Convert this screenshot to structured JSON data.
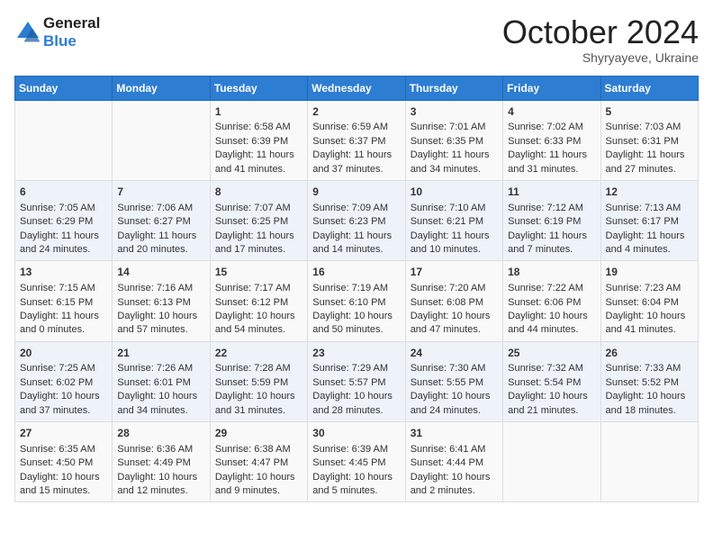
{
  "header": {
    "logo_line1": "General",
    "logo_line2": "Blue",
    "month_title": "October 2024",
    "subtitle": "Shyryayeve, Ukraine"
  },
  "days_of_week": [
    "Sunday",
    "Monday",
    "Tuesday",
    "Wednesday",
    "Thursday",
    "Friday",
    "Saturday"
  ],
  "weeks": [
    [
      {
        "day": "",
        "lines": []
      },
      {
        "day": "",
        "lines": []
      },
      {
        "day": "1",
        "lines": [
          "Sunrise: 6:58 AM",
          "Sunset: 6:39 PM",
          "Daylight: 11 hours and 41 minutes."
        ]
      },
      {
        "day": "2",
        "lines": [
          "Sunrise: 6:59 AM",
          "Sunset: 6:37 PM",
          "Daylight: 11 hours and 37 minutes."
        ]
      },
      {
        "day": "3",
        "lines": [
          "Sunrise: 7:01 AM",
          "Sunset: 6:35 PM",
          "Daylight: 11 hours and 34 minutes."
        ]
      },
      {
        "day": "4",
        "lines": [
          "Sunrise: 7:02 AM",
          "Sunset: 6:33 PM",
          "Daylight: 11 hours and 31 minutes."
        ]
      },
      {
        "day": "5",
        "lines": [
          "Sunrise: 7:03 AM",
          "Sunset: 6:31 PM",
          "Daylight: 11 hours and 27 minutes."
        ]
      }
    ],
    [
      {
        "day": "6",
        "lines": [
          "Sunrise: 7:05 AM",
          "Sunset: 6:29 PM",
          "Daylight: 11 hours and 24 minutes."
        ]
      },
      {
        "day": "7",
        "lines": [
          "Sunrise: 7:06 AM",
          "Sunset: 6:27 PM",
          "Daylight: 11 hours and 20 minutes."
        ]
      },
      {
        "day": "8",
        "lines": [
          "Sunrise: 7:07 AM",
          "Sunset: 6:25 PM",
          "Daylight: 11 hours and 17 minutes."
        ]
      },
      {
        "day": "9",
        "lines": [
          "Sunrise: 7:09 AM",
          "Sunset: 6:23 PM",
          "Daylight: 11 hours and 14 minutes."
        ]
      },
      {
        "day": "10",
        "lines": [
          "Sunrise: 7:10 AM",
          "Sunset: 6:21 PM",
          "Daylight: 11 hours and 10 minutes."
        ]
      },
      {
        "day": "11",
        "lines": [
          "Sunrise: 7:12 AM",
          "Sunset: 6:19 PM",
          "Daylight: 11 hours and 7 minutes."
        ]
      },
      {
        "day": "12",
        "lines": [
          "Sunrise: 7:13 AM",
          "Sunset: 6:17 PM",
          "Daylight: 11 hours and 4 minutes."
        ]
      }
    ],
    [
      {
        "day": "13",
        "lines": [
          "Sunrise: 7:15 AM",
          "Sunset: 6:15 PM",
          "Daylight: 11 hours and 0 minutes."
        ]
      },
      {
        "day": "14",
        "lines": [
          "Sunrise: 7:16 AM",
          "Sunset: 6:13 PM",
          "Daylight: 10 hours and 57 minutes."
        ]
      },
      {
        "day": "15",
        "lines": [
          "Sunrise: 7:17 AM",
          "Sunset: 6:12 PM",
          "Daylight: 10 hours and 54 minutes."
        ]
      },
      {
        "day": "16",
        "lines": [
          "Sunrise: 7:19 AM",
          "Sunset: 6:10 PM",
          "Daylight: 10 hours and 50 minutes."
        ]
      },
      {
        "day": "17",
        "lines": [
          "Sunrise: 7:20 AM",
          "Sunset: 6:08 PM",
          "Daylight: 10 hours and 47 minutes."
        ]
      },
      {
        "day": "18",
        "lines": [
          "Sunrise: 7:22 AM",
          "Sunset: 6:06 PM",
          "Daylight: 10 hours and 44 minutes."
        ]
      },
      {
        "day": "19",
        "lines": [
          "Sunrise: 7:23 AM",
          "Sunset: 6:04 PM",
          "Daylight: 10 hours and 41 minutes."
        ]
      }
    ],
    [
      {
        "day": "20",
        "lines": [
          "Sunrise: 7:25 AM",
          "Sunset: 6:02 PM",
          "Daylight: 10 hours and 37 minutes."
        ]
      },
      {
        "day": "21",
        "lines": [
          "Sunrise: 7:26 AM",
          "Sunset: 6:01 PM",
          "Daylight: 10 hours and 34 minutes."
        ]
      },
      {
        "day": "22",
        "lines": [
          "Sunrise: 7:28 AM",
          "Sunset: 5:59 PM",
          "Daylight: 10 hours and 31 minutes."
        ]
      },
      {
        "day": "23",
        "lines": [
          "Sunrise: 7:29 AM",
          "Sunset: 5:57 PM",
          "Daylight: 10 hours and 28 minutes."
        ]
      },
      {
        "day": "24",
        "lines": [
          "Sunrise: 7:30 AM",
          "Sunset: 5:55 PM",
          "Daylight: 10 hours and 24 minutes."
        ]
      },
      {
        "day": "25",
        "lines": [
          "Sunrise: 7:32 AM",
          "Sunset: 5:54 PM",
          "Daylight: 10 hours and 21 minutes."
        ]
      },
      {
        "day": "26",
        "lines": [
          "Sunrise: 7:33 AM",
          "Sunset: 5:52 PM",
          "Daylight: 10 hours and 18 minutes."
        ]
      }
    ],
    [
      {
        "day": "27",
        "lines": [
          "Sunrise: 6:35 AM",
          "Sunset: 4:50 PM",
          "Daylight: 10 hours and 15 minutes."
        ]
      },
      {
        "day": "28",
        "lines": [
          "Sunrise: 6:36 AM",
          "Sunset: 4:49 PM",
          "Daylight: 10 hours and 12 minutes."
        ]
      },
      {
        "day": "29",
        "lines": [
          "Sunrise: 6:38 AM",
          "Sunset: 4:47 PM",
          "Daylight: 10 hours and 9 minutes."
        ]
      },
      {
        "day": "30",
        "lines": [
          "Sunrise: 6:39 AM",
          "Sunset: 4:45 PM",
          "Daylight: 10 hours and 5 minutes."
        ]
      },
      {
        "day": "31",
        "lines": [
          "Sunrise: 6:41 AM",
          "Sunset: 4:44 PM",
          "Daylight: 10 hours and 2 minutes."
        ]
      },
      {
        "day": "",
        "lines": []
      },
      {
        "day": "",
        "lines": []
      }
    ]
  ]
}
